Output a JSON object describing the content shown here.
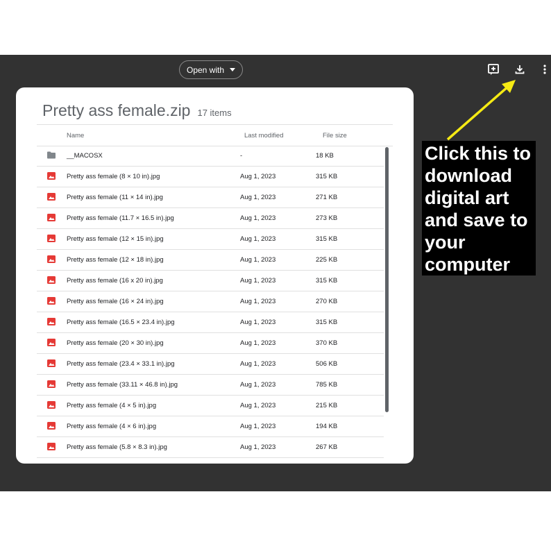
{
  "toolbar": {
    "open_with_label": "Open with",
    "add_shortcut_icon": "add-to-drive-icon",
    "download_icon": "download-icon",
    "more_icon": "more-vert-icon"
  },
  "archive": {
    "title": "Pretty ass female.zip",
    "item_count": "17 items",
    "columns": {
      "name": "Name",
      "modified": "Last modified",
      "size": "File size"
    },
    "rows": [
      {
        "type": "folder",
        "name": "__MACOSX",
        "modified": "-",
        "size": "18 KB"
      },
      {
        "type": "image",
        "name": "Pretty ass female (8 × 10 in).jpg",
        "modified": "Aug 1, 2023",
        "size": "315 KB"
      },
      {
        "type": "image",
        "name": "Pretty ass female (11 × 14 in).jpg",
        "modified": "Aug 1, 2023",
        "size": "271 KB"
      },
      {
        "type": "image",
        "name": "Pretty ass female (11.7 × 16.5 in).jpg",
        "modified": "Aug 1, 2023",
        "size": "273 KB"
      },
      {
        "type": "image",
        "name": "Pretty ass female (12 × 15 in).jpg",
        "modified": "Aug 1, 2023",
        "size": "315 KB"
      },
      {
        "type": "image",
        "name": "Pretty ass female (12 × 18 in).jpg",
        "modified": "Aug 1, 2023",
        "size": "225 KB"
      },
      {
        "type": "image",
        "name": "Pretty ass female (16 x 20 in).jpg",
        "modified": "Aug 1, 2023",
        "size": "315 KB"
      },
      {
        "type": "image",
        "name": "Pretty ass female (16 × 24 in).jpg",
        "modified": "Aug 1, 2023",
        "size": "270 KB"
      },
      {
        "type": "image",
        "name": "Pretty ass female (16.5 × 23.4 in).jpg",
        "modified": "Aug 1, 2023",
        "size": "315 KB"
      },
      {
        "type": "image",
        "name": "Pretty ass female (20 × 30 in).jpg",
        "modified": "Aug 1, 2023",
        "size": "370 KB"
      },
      {
        "type": "image",
        "name": "Pretty ass female (23.4 × 33.1 in).jpg",
        "modified": "Aug 1, 2023",
        "size": "506 KB"
      },
      {
        "type": "image",
        "name": "Pretty ass female (33.11 × 46.8 in).jpg",
        "modified": "Aug 1, 2023",
        "size": "785 KB"
      },
      {
        "type": "image",
        "name": "Pretty ass female (4 × 5 in).jpg",
        "modified": "Aug 1, 2023",
        "size": "215 KB"
      },
      {
        "type": "image",
        "name": "Pretty ass female (4 × 6 in).jpg",
        "modified": "Aug 1, 2023",
        "size": "194 KB"
      },
      {
        "type": "image",
        "name": "Pretty ass female (5.8 × 8.3 in).jpg",
        "modified": "Aug 1, 2023",
        "size": "267 KB"
      }
    ]
  },
  "callout": {
    "text": "Click this to download digital art and save to your computer"
  },
  "colors": {
    "viewer_bg": "#323232",
    "image_icon": "#e53935",
    "folder_icon": "#80868b",
    "arrow": "#f5ea14"
  }
}
